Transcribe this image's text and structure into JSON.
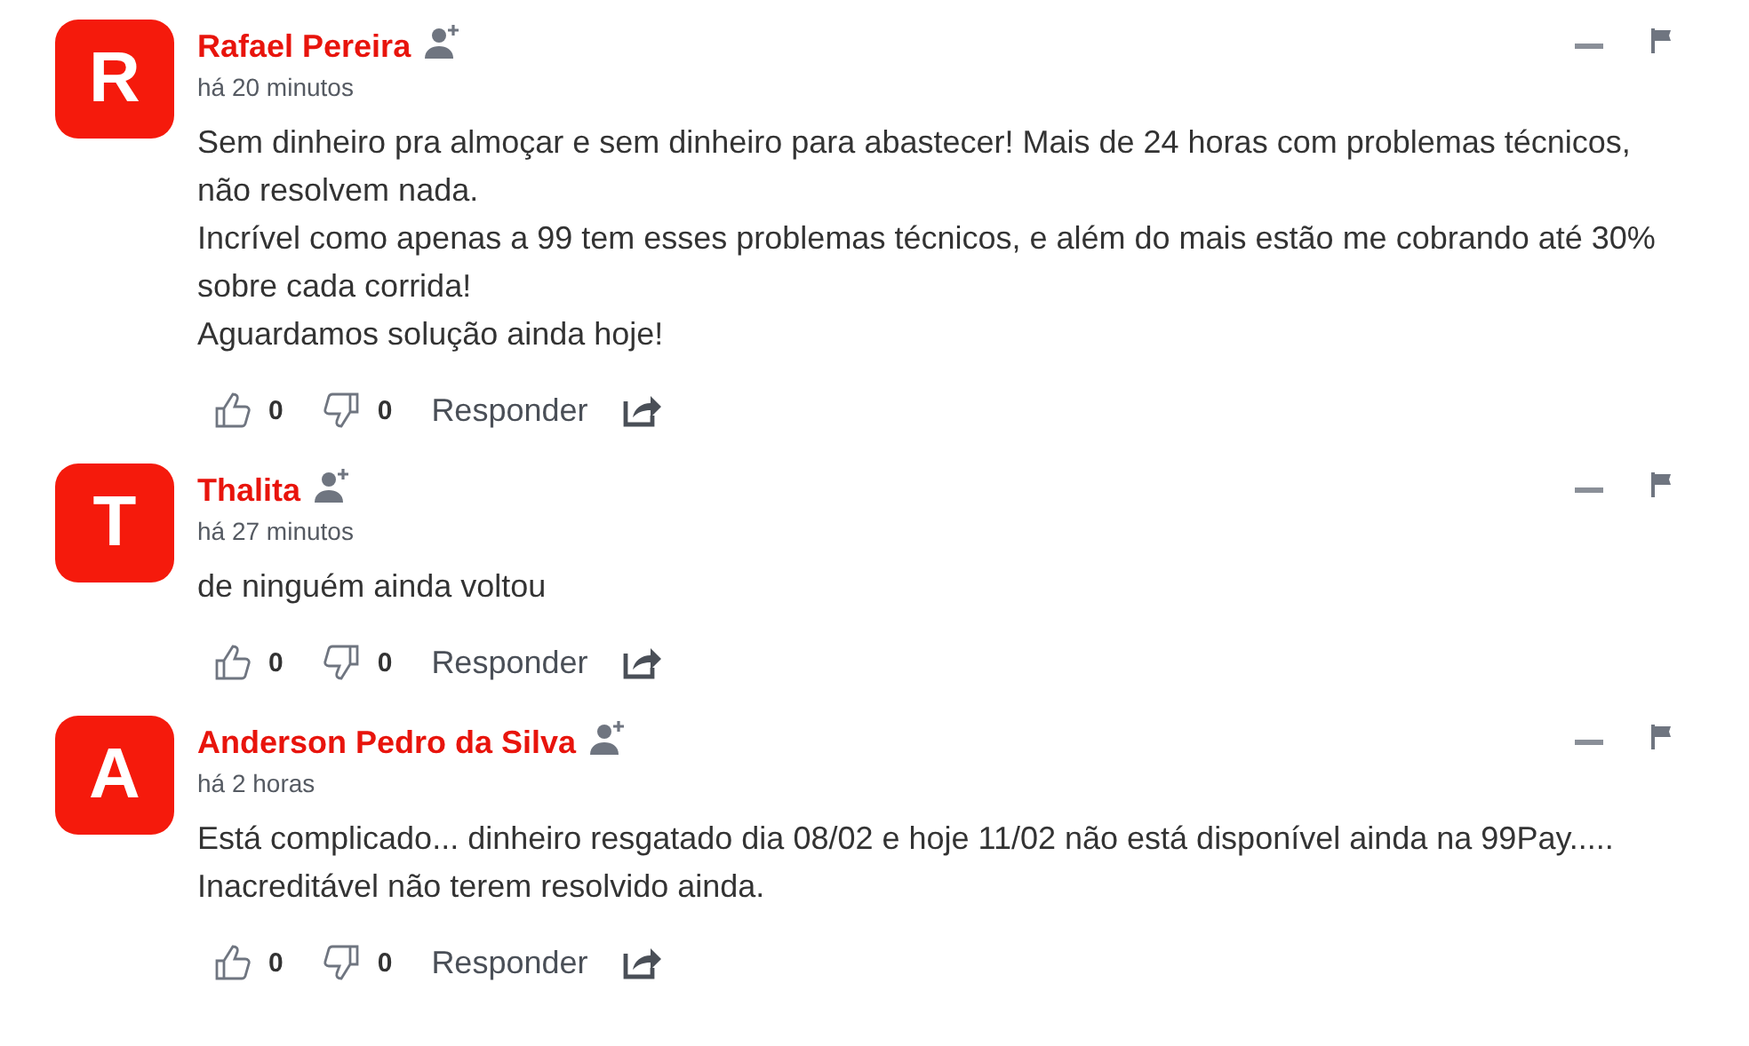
{
  "comments": [
    {
      "avatar": "R",
      "author": "Rafael Pereira",
      "time": "há 20 minutos",
      "paragraphs": [
        "Sem dinheiro pra almoçar e sem dinheiro para abastecer! Mais de 24 horas com problemas técnicos, não resolvem nada.",
        "Incrível como apenas a 99 tem esses problemas técnicos, e além do mais estão me cobrando até 30% sobre cada corrida!",
        "Aguardamos solução ainda hoje!"
      ],
      "likes": "0",
      "dislikes": "0",
      "reply": "Responder"
    },
    {
      "avatar": "T",
      "author": "Thalita",
      "time": "há 27 minutos",
      "paragraphs": [
        "de ninguém ainda voltou"
      ],
      "likes": "0",
      "dislikes": "0",
      "reply": "Responder"
    },
    {
      "avatar": "A",
      "author": "Anderson Pedro da Silva",
      "time": "há 2 horas",
      "paragraphs": [
        "Está complicado... dinheiro resgatado dia 08/02 e hoje 11/02 não está disponível ainda na 99Pay..... Inacreditável não terem resolvido ainda."
      ],
      "likes": "0",
      "dislikes": "0",
      "reply": "Responder"
    }
  ]
}
